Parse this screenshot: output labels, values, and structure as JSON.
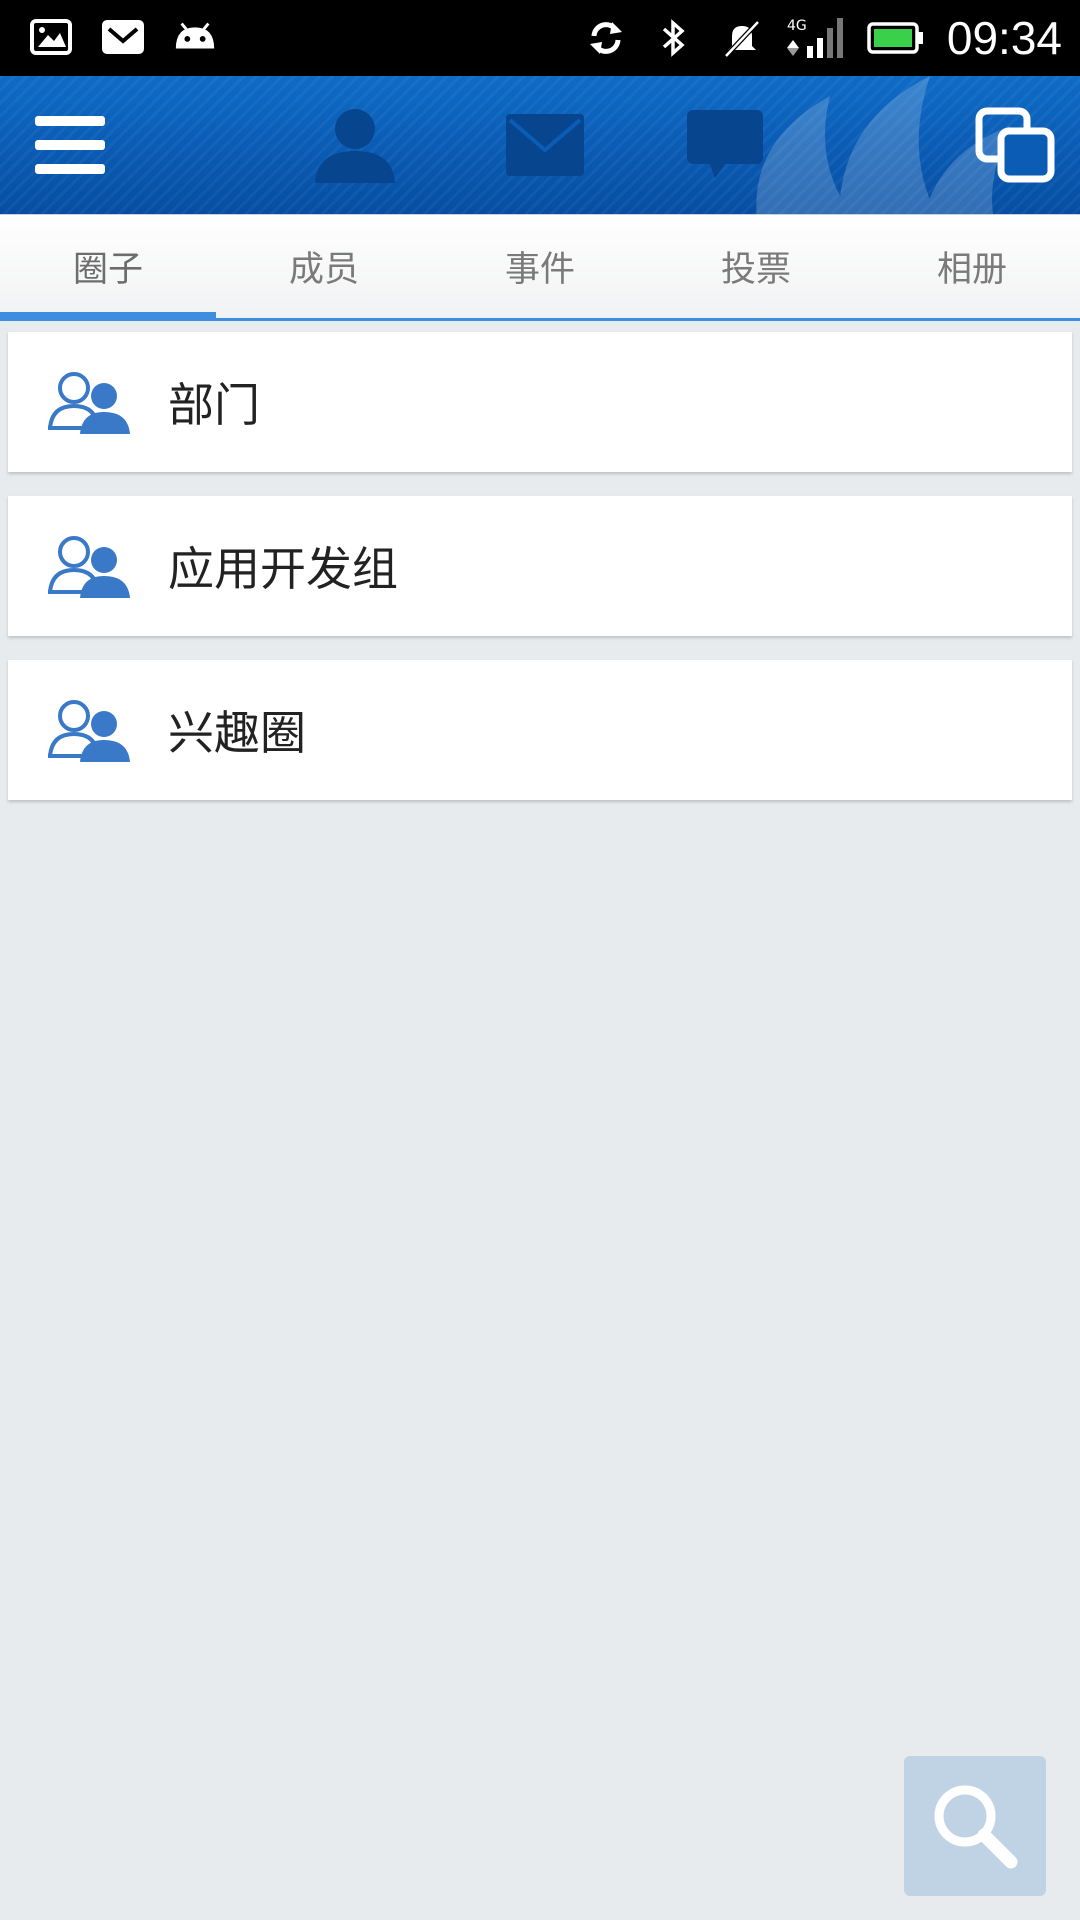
{
  "status_bar": {
    "time": "09:34",
    "network": "4G",
    "left_icons": [
      "image-icon",
      "mail-notification-icon",
      "android-icon"
    ],
    "right_icons": [
      "sync-icon",
      "bluetooth-icon",
      "mute-icon",
      "signal-icon",
      "battery-icon"
    ]
  },
  "action_bar": {
    "icons": [
      "menu-icon",
      "person-icon",
      "mail-icon",
      "chat-icon",
      "windows-icon"
    ]
  },
  "tabs": [
    {
      "label": "圈子",
      "active": true
    },
    {
      "label": "成员",
      "active": false
    },
    {
      "label": "事件",
      "active": false
    },
    {
      "label": "投票",
      "active": false
    },
    {
      "label": "相册",
      "active": false
    }
  ],
  "groups": [
    {
      "label": "部门",
      "icon": "group-icon"
    },
    {
      "label": "应用开发组",
      "icon": "group-icon"
    },
    {
      "label": "兴趣圈",
      "icon": "group-icon"
    }
  ],
  "colors": {
    "accent": "#3e8de0",
    "action_bar": "#0a5cb5",
    "background": "#e8ebed",
    "icon_blue": "#3a78c8"
  },
  "fab": {
    "icon": "search-icon"
  }
}
